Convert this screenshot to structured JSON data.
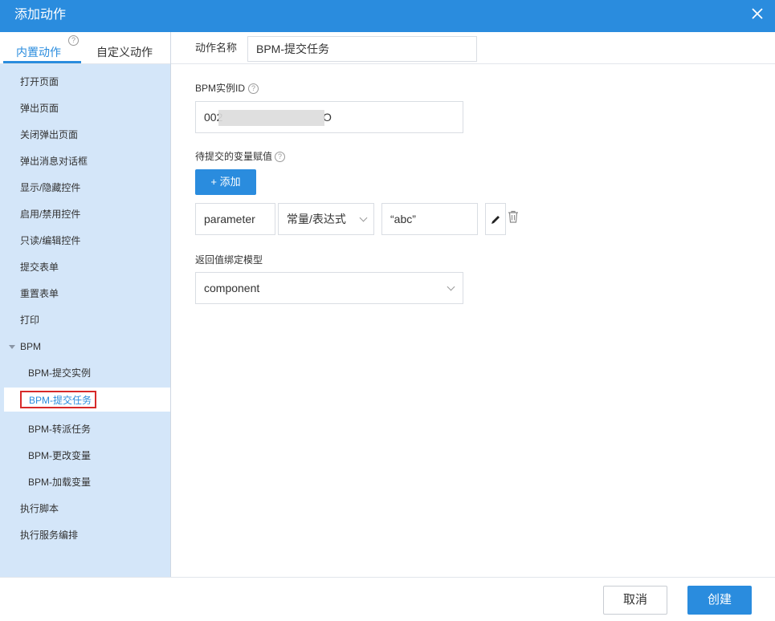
{
  "dialog": {
    "title": "添加动作",
    "close_icon": "close-icon"
  },
  "sidebar": {
    "tabs": [
      {
        "label": "内置动作",
        "active": true
      },
      {
        "label": "自定义动作",
        "active": false
      }
    ],
    "help_glyph": "?",
    "items": [
      {
        "label": "打开页面"
      },
      {
        "label": "弹出页面"
      },
      {
        "label": "关闭弹出页面"
      },
      {
        "label": "弹出消息对话框"
      },
      {
        "label": "显示/隐藏控件"
      },
      {
        "label": "启用/禁用控件"
      },
      {
        "label": "只读/编辑控件"
      },
      {
        "label": "提交表单"
      },
      {
        "label": "重置表单"
      },
      {
        "label": "打印"
      },
      {
        "label": "BPM",
        "group": true,
        "expanded": true
      },
      {
        "label": "BPM-提交实例",
        "child": true
      },
      {
        "label": "BPM-提交任务",
        "child": true,
        "selected": true
      },
      {
        "label": "BPM-转派任务",
        "child": true
      },
      {
        "label": "BPM-更改变量",
        "child": true
      },
      {
        "label": "BPM-加载变量",
        "child": true
      },
      {
        "label": "执行脚本"
      },
      {
        "label": "执行服务编排"
      }
    ]
  },
  "form": {
    "action_name_label": "动作名称",
    "action_name_value": "BPM-提交任务",
    "instance_id_label": "BPM实例ID",
    "instance_id_prefix": "002",
    "instance_id_suffix": "O",
    "variables_label": "待提交的变量赋值",
    "add_button": "+ 添加",
    "variable_row": {
      "name": "parameter",
      "type": "常量/表达式",
      "value": "“abc”"
    },
    "return_label": "返回值绑定模型",
    "return_value": "component"
  },
  "footer": {
    "cancel": "取消",
    "create": "创建"
  },
  "colors": {
    "accent": "#2a8cde",
    "sidebar_bg": "#d4e6f9",
    "highlight": "#d72a2a"
  }
}
